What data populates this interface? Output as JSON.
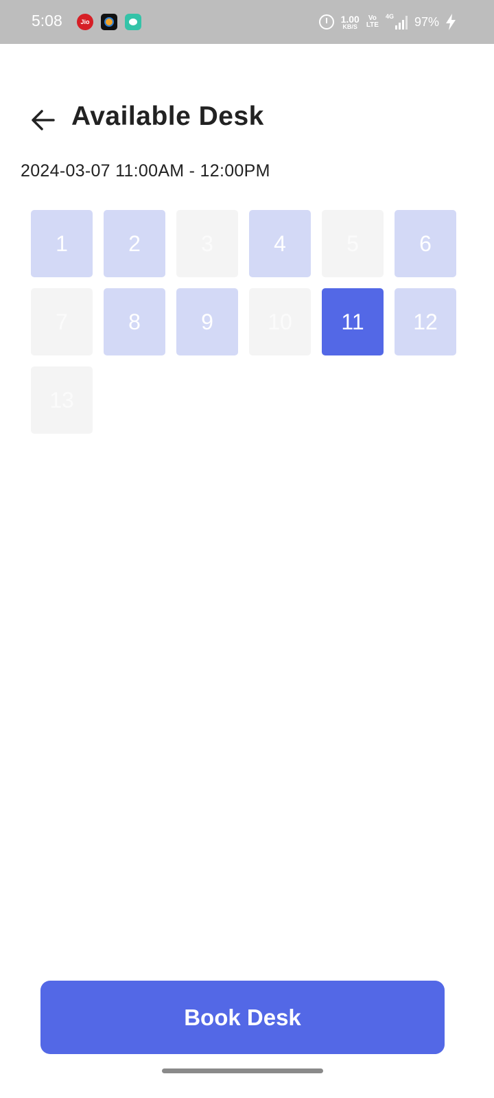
{
  "status_bar": {
    "time": "5:08",
    "jio_label": "Jio",
    "network_speed": "1.00",
    "network_speed_unit": "KB/S",
    "volte_line1": "Vo",
    "volte_line2": "LTE",
    "network_type": "4G",
    "battery": "97%"
  },
  "header": {
    "title": "Available Desk",
    "back_icon": "arrow-left-icon"
  },
  "session": {
    "datetime": "2024-03-07 11:00AM - 12:00PM"
  },
  "desks": [
    {
      "label": "1",
      "status": "available"
    },
    {
      "label": "2",
      "status": "available"
    },
    {
      "label": "3",
      "status": "unavailable"
    },
    {
      "label": "4",
      "status": "available"
    },
    {
      "label": "5",
      "status": "unavailable"
    },
    {
      "label": "6",
      "status": "available"
    },
    {
      "label": "7",
      "status": "unavailable"
    },
    {
      "label": "8",
      "status": "available"
    },
    {
      "label": "9",
      "status": "available"
    },
    {
      "label": "10",
      "status": "unavailable"
    },
    {
      "label": "11",
      "status": "selected"
    },
    {
      "label": "12",
      "status": "available"
    },
    {
      "label": "13",
      "status": "unavailable"
    }
  ],
  "footer": {
    "book_label": "Book Desk"
  },
  "colors": {
    "accent": "#5368e6",
    "available": "#d3d9f6",
    "unavailable": "#f4f4f4",
    "status_bar": "#bdbdbd"
  }
}
